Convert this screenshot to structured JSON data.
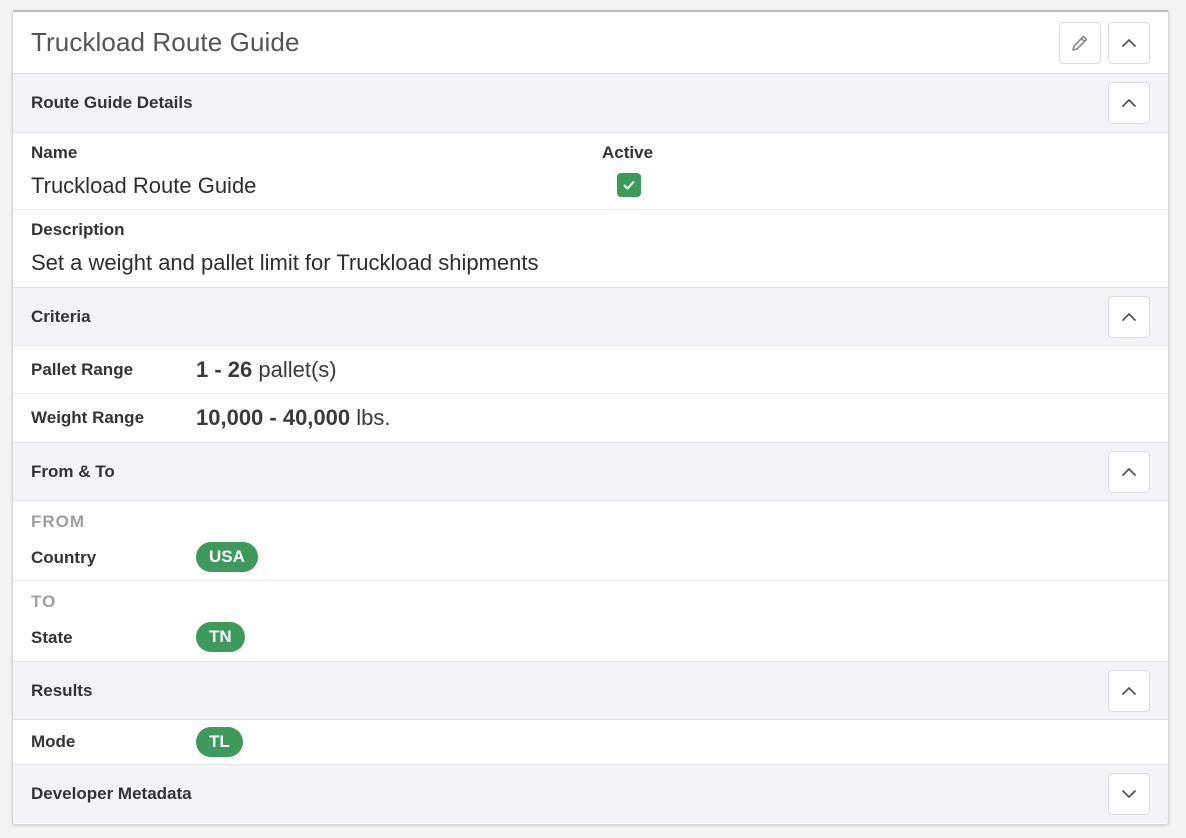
{
  "card": {
    "title": "Truckload Route Guide",
    "edit_icon": "pencil-icon",
    "collapse_icon": "chevron-up-icon"
  },
  "details": {
    "section_title": "Route Guide Details",
    "name_label": "Name",
    "name_value": "Truckload Route Guide",
    "active_label": "Active",
    "active_checked": true,
    "description_label": "Description",
    "description_value": "Set a weight and pallet limit for Truckload shipments"
  },
  "criteria": {
    "section_title": "Criteria",
    "pallet_label": "Pallet Range",
    "pallet_range": "1 - 26",
    "pallet_unit": "pallet(s)",
    "weight_label": "Weight Range",
    "weight_range": "10,000 - 40,000",
    "weight_unit": "lbs."
  },
  "from_to": {
    "section_title": "From & To",
    "from_label": "FROM",
    "country_label": "Country",
    "country_value": "USA",
    "to_label": "TO",
    "state_label": "State",
    "state_value": "TN"
  },
  "results": {
    "section_title": "Results",
    "mode_label": "Mode",
    "mode_value": "TL"
  },
  "developer": {
    "section_title": "Developer Metadata"
  },
  "colors": {
    "accent_green": "#3d9a5a",
    "section_bg": "#f4f4f8"
  }
}
